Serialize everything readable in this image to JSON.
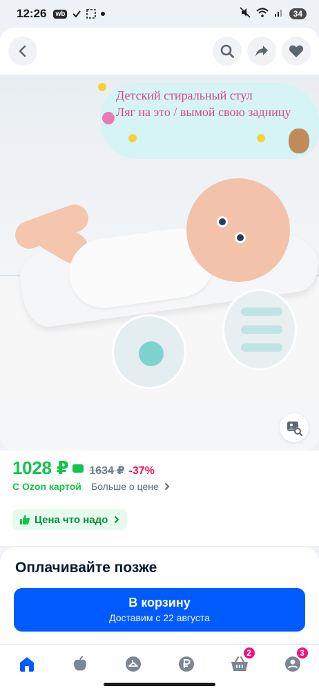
{
  "status_bar": {
    "time": "12:26",
    "app_badge": "wb",
    "battery": "34"
  },
  "product_image": {
    "caption_line1": "Детский стиральный стул",
    "caption_line2": "Ляг на это / вымой свою задницу"
  },
  "price": {
    "current": "1028 ₽",
    "old": "1634 ₽",
    "discount": "-37%",
    "ozon_card_label": "С Ozon картой",
    "more_about_price": "Больше о цене"
  },
  "badge": {
    "label": "Цена что надо"
  },
  "payment": {
    "title": "Оплачивайте позже",
    "cart_button_label": "В корзину",
    "cart_button_sublabel": "Доставим с 22 августа"
  },
  "nav": {
    "cart_count": "2",
    "profile_count": "3"
  },
  "colors": {
    "price_green": "#10c44c",
    "discount_red": "#f91155",
    "primary_blue": "#005bff",
    "badge_pink": "#f1117e"
  }
}
